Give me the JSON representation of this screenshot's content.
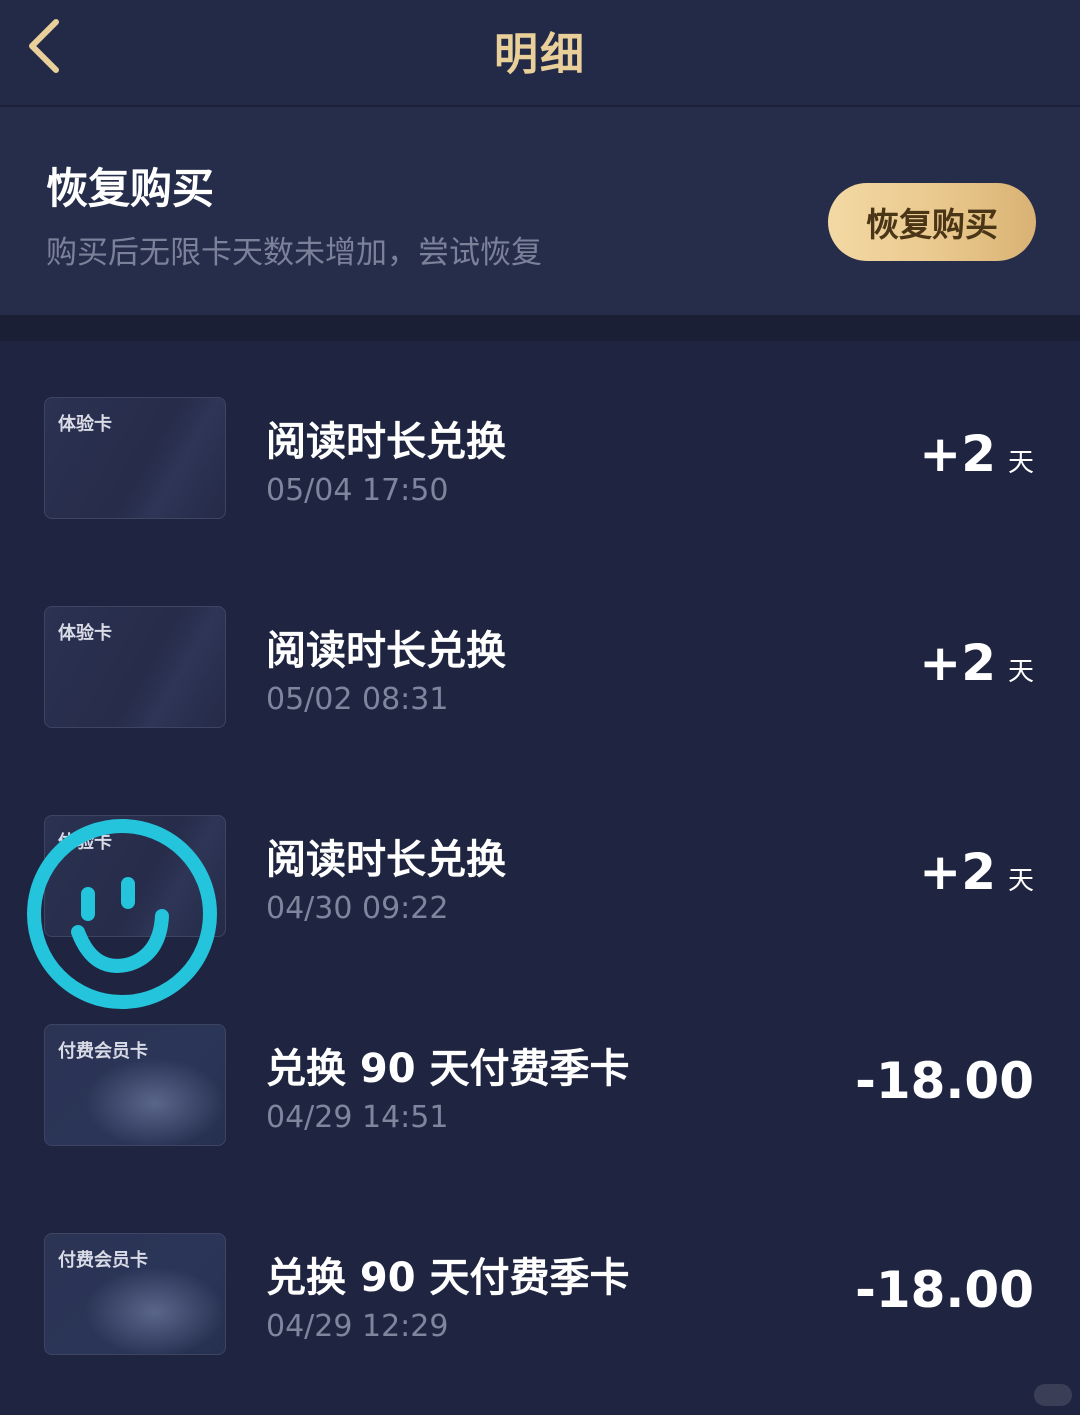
{
  "header": {
    "title": "明细",
    "back_icon": "chevron-left-icon",
    "accent": "#e9cf9a"
  },
  "restore": {
    "title": "恢复购买",
    "description": "购买后无限卡天数未增加，尝试恢复",
    "button_label": "恢复购买"
  },
  "records": [
    {
      "card_label": "体验卡",
      "card_type": "trial",
      "title": "阅读时长兑换",
      "time": "05/04 17:50",
      "amount": "+2",
      "unit": "天"
    },
    {
      "card_label": "体验卡",
      "card_type": "trial",
      "title": "阅读时长兑换",
      "time": "05/02 08:31",
      "amount": "+2",
      "unit": "天"
    },
    {
      "card_label": "体验卡",
      "card_type": "trial",
      "title": "阅读时长兑换",
      "time": "04/30 09:22",
      "amount": "+2",
      "unit": "天"
    },
    {
      "card_label": "付费会员卡",
      "card_type": "paid",
      "title": "兑换 90 天付费季卡",
      "time": "04/29 14:51",
      "amount": "-18.00",
      "unit": ""
    },
    {
      "card_label": "付费会员卡",
      "card_type": "paid",
      "title": "兑换 90 天付费季卡",
      "time": "04/29 12:29",
      "amount": "-18.00",
      "unit": ""
    }
  ],
  "sticker": {
    "icon": "smiley-face-icon",
    "color": "#23c4dc"
  }
}
